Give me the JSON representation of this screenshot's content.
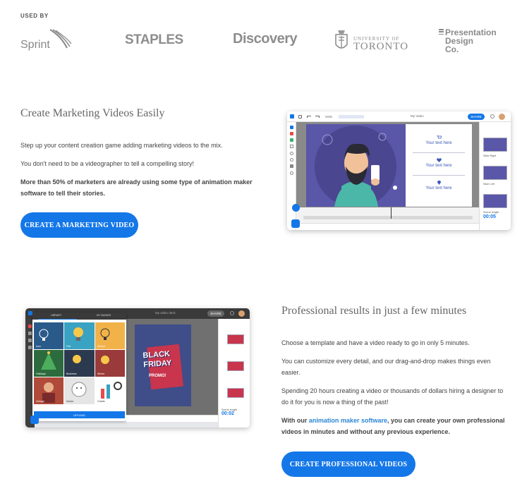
{
  "used_by": {
    "label": "USED BY",
    "logos": {
      "sprint": "Sprint",
      "staples": "STAPLES",
      "discovery": "Discovery",
      "toronto_university": "UNIVERSITY OF",
      "toronto_name": "TORONTO",
      "pd_line1": "Presentation",
      "pd_line2": "Design",
      "pd_line3": "Co."
    }
  },
  "section1": {
    "heading": "Create Marketing Videos Easily",
    "p1": "Step up your content creation game adding marketing videos to the mix.",
    "p2": "You don't need to be a videographer to tell a compelling story!",
    "p3": "More than 50% of marketers are already using some type of animation maker software to tell their stories.",
    "cta": "CREATE A MARKETING VIDEO",
    "editor": {
      "title": "My Video",
      "share": "SHARE",
      "text_box": "Your text here",
      "scene1_label": "Slide Right",
      "scene2_label": "Slide Left",
      "duration": "00:05",
      "duration_label": "Scene length"
    }
  },
  "section2": {
    "heading": "Professional results in just a few minutes",
    "p1": "Choose a template and have a video ready to go in only 5 minutes.",
    "p2": "You can customize every detail, and our drag-and-drop makes things even easier.",
    "p3": "Spending 20 hours creating a video or thousands of dollars hiring a designer to do it for you is now a thing of the past!",
    "p4_prefix": "With our ",
    "p4_link": "animation maker software",
    "p4_suffix": ", you can create your own professional videos in minutes and without any previous experience.",
    "cta": "CREATE PROFESSIONAL VIDEOS",
    "editor": {
      "title": "My video deck",
      "share": "SHARE",
      "lib_tab1": "LIBRARY",
      "lib_tab2": "MY IMAGES",
      "tiles": [
        "Icon",
        "Flat",
        "Sketch",
        "Holidays",
        "Business",
        "Winter",
        "Vintage",
        "Vector",
        "Charts"
      ],
      "upload": "UPLOAD",
      "bf_line1": "BLACK",
      "bf_line2": "FRIDAY",
      "bf_line3": "PROMO!",
      "duration": "00:02",
      "duration_label": "Scene length"
    }
  },
  "colors": {
    "primary": "#1477e8",
    "canvas_purple": "#5a56a8",
    "link": "#2a86d6"
  }
}
